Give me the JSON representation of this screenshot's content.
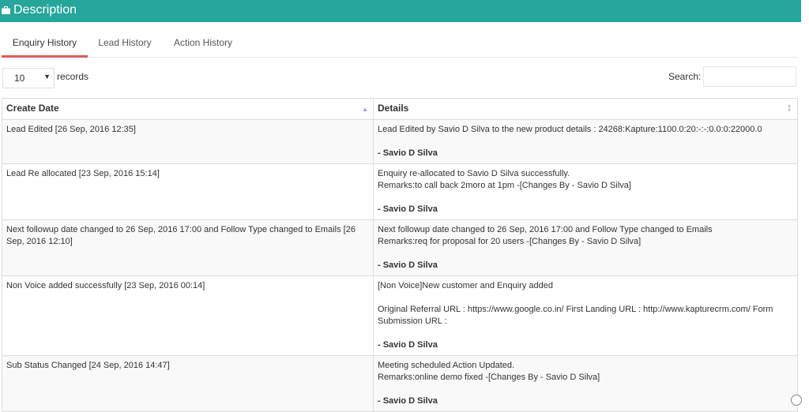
{
  "header": {
    "title": "Description",
    "icon": "briefcase-icon"
  },
  "tabs": [
    {
      "label": "Enquiry History",
      "active": true
    },
    {
      "label": "Lead History",
      "active": false
    },
    {
      "label": "Action History",
      "active": false
    }
  ],
  "length": {
    "value": "10",
    "label": "records"
  },
  "search": {
    "label": "Search:",
    "value": "",
    "placeholder": ""
  },
  "table": {
    "columns": [
      "Create Date",
      "Details"
    ],
    "rows": [
      {
        "create_date": "Lead Edited [26 Sep, 2016 12:35]",
        "lines": [
          "Lead Edited by Savio D Silva to the new product details : 24268:Kapture:1100.0:20:-:-:0.0:0:22000.0"
        ],
        "signature": "- Savio D Silva"
      },
      {
        "create_date": "Lead Re allocated [23 Sep, 2016 15:14]",
        "lines": [
          "Enquiry re-allocated to Savio D Silva successfully.",
          "Remarks:to call back 2moro at 1pm -[Changes By - Savio D Silva]"
        ],
        "signature": "- Savio D Silva"
      },
      {
        "create_date": "Next followup date changed to 26 Sep, 2016 17:00 and Follow Type changed to Emails [26 Sep, 2016 12:10]",
        "lines": [
          "Next followup date changed to 26 Sep, 2016 17:00 and Follow Type changed to Emails",
          "Remarks:req for proposal for 20 users -[Changes By - Savio D Silva]"
        ],
        "signature": "- Savio D Silva"
      },
      {
        "create_date": "Non Voice added successfully [23 Sep, 2016 00:14]",
        "lines": [
          "[Non Voice]New customer and Enquiry added",
          "",
          "Original Referral URL : https://www.google.co.in/ First Landing URL : http://www.kapturecrm.com/ Form Submission URL :"
        ],
        "signature": "- Savio D Silva"
      },
      {
        "create_date": "Sub Status Changed [24 Sep, 2016 14:47]",
        "lines": [
          "Meeting scheduled Action Updated.",
          "Remarks:online demo fixed -[Changes By - Savio D Silva]"
        ],
        "signature": "- Savio D Silva"
      }
    ]
  }
}
